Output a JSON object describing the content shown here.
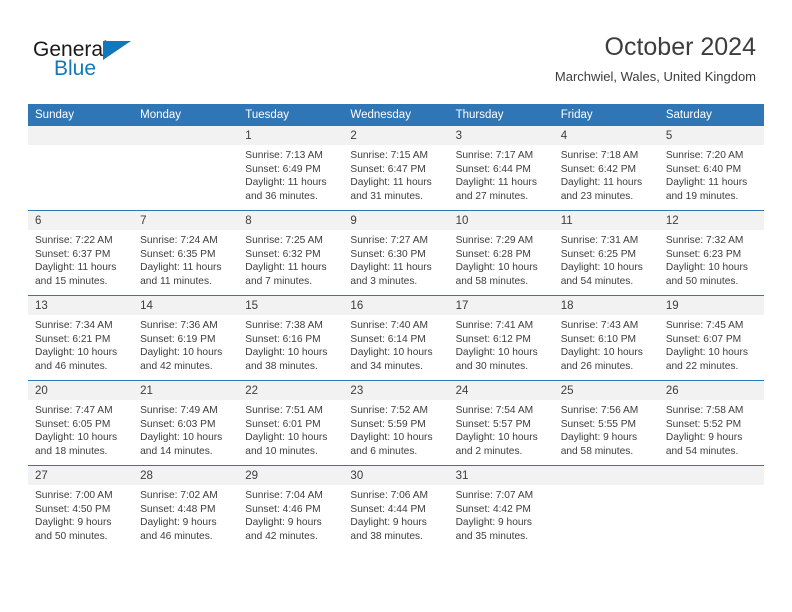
{
  "logo": {
    "word1": "General",
    "word2": "Blue",
    "triangle_color": "#1278be",
    "text_color": "#1a1a1a"
  },
  "header": {
    "title": "October 2024",
    "subtitle": "Marchwiel, Wales, United Kingdom"
  },
  "theme": {
    "header_bg": "#2f76b6",
    "daynum_bg": "#f2f2f2",
    "text": "#3d3d3d",
    "rule": "#2f76b6"
  },
  "weekday_headers": [
    "Sunday",
    "Monday",
    "Tuesday",
    "Wednesday",
    "Thursday",
    "Friday",
    "Saturday"
  ],
  "labels": {
    "sunrise_prefix": "Sunrise:",
    "sunset_prefix": "Sunset:",
    "daylight_prefix": "Daylight:"
  },
  "weeks": [
    [
      {
        "day": "",
        "sunrise": "",
        "sunset": "",
        "daylight_l1": "",
        "daylight_l2": ""
      },
      {
        "day": "",
        "sunrise": "",
        "sunset": "",
        "daylight_l1": "",
        "daylight_l2": ""
      },
      {
        "day": "1",
        "sunrise": "Sunrise: 7:13 AM",
        "sunset": "Sunset: 6:49 PM",
        "daylight_l1": "Daylight: 11 hours",
        "daylight_l2": "and 36 minutes."
      },
      {
        "day": "2",
        "sunrise": "Sunrise: 7:15 AM",
        "sunset": "Sunset: 6:47 PM",
        "daylight_l1": "Daylight: 11 hours",
        "daylight_l2": "and 31 minutes."
      },
      {
        "day": "3",
        "sunrise": "Sunrise: 7:17 AM",
        "sunset": "Sunset: 6:44 PM",
        "daylight_l1": "Daylight: 11 hours",
        "daylight_l2": "and 27 minutes."
      },
      {
        "day": "4",
        "sunrise": "Sunrise: 7:18 AM",
        "sunset": "Sunset: 6:42 PM",
        "daylight_l1": "Daylight: 11 hours",
        "daylight_l2": "and 23 minutes."
      },
      {
        "day": "5",
        "sunrise": "Sunrise: 7:20 AM",
        "sunset": "Sunset: 6:40 PM",
        "daylight_l1": "Daylight: 11 hours",
        "daylight_l2": "and 19 minutes."
      }
    ],
    [
      {
        "day": "6",
        "sunrise": "Sunrise: 7:22 AM",
        "sunset": "Sunset: 6:37 PM",
        "daylight_l1": "Daylight: 11 hours",
        "daylight_l2": "and 15 minutes."
      },
      {
        "day": "7",
        "sunrise": "Sunrise: 7:24 AM",
        "sunset": "Sunset: 6:35 PM",
        "daylight_l1": "Daylight: 11 hours",
        "daylight_l2": "and 11 minutes."
      },
      {
        "day": "8",
        "sunrise": "Sunrise: 7:25 AM",
        "sunset": "Sunset: 6:32 PM",
        "daylight_l1": "Daylight: 11 hours",
        "daylight_l2": "and 7 minutes."
      },
      {
        "day": "9",
        "sunrise": "Sunrise: 7:27 AM",
        "sunset": "Sunset: 6:30 PM",
        "daylight_l1": "Daylight: 11 hours",
        "daylight_l2": "and 3 minutes."
      },
      {
        "day": "10",
        "sunrise": "Sunrise: 7:29 AM",
        "sunset": "Sunset: 6:28 PM",
        "daylight_l1": "Daylight: 10 hours",
        "daylight_l2": "and 58 minutes."
      },
      {
        "day": "11",
        "sunrise": "Sunrise: 7:31 AM",
        "sunset": "Sunset: 6:25 PM",
        "daylight_l1": "Daylight: 10 hours",
        "daylight_l2": "and 54 minutes."
      },
      {
        "day": "12",
        "sunrise": "Sunrise: 7:32 AM",
        "sunset": "Sunset: 6:23 PM",
        "daylight_l1": "Daylight: 10 hours",
        "daylight_l2": "and 50 minutes."
      }
    ],
    [
      {
        "day": "13",
        "sunrise": "Sunrise: 7:34 AM",
        "sunset": "Sunset: 6:21 PM",
        "daylight_l1": "Daylight: 10 hours",
        "daylight_l2": "and 46 minutes."
      },
      {
        "day": "14",
        "sunrise": "Sunrise: 7:36 AM",
        "sunset": "Sunset: 6:19 PM",
        "daylight_l1": "Daylight: 10 hours",
        "daylight_l2": "and 42 minutes."
      },
      {
        "day": "15",
        "sunrise": "Sunrise: 7:38 AM",
        "sunset": "Sunset: 6:16 PM",
        "daylight_l1": "Daylight: 10 hours",
        "daylight_l2": "and 38 minutes."
      },
      {
        "day": "16",
        "sunrise": "Sunrise: 7:40 AM",
        "sunset": "Sunset: 6:14 PM",
        "daylight_l1": "Daylight: 10 hours",
        "daylight_l2": "and 34 minutes."
      },
      {
        "day": "17",
        "sunrise": "Sunrise: 7:41 AM",
        "sunset": "Sunset: 6:12 PM",
        "daylight_l1": "Daylight: 10 hours",
        "daylight_l2": "and 30 minutes."
      },
      {
        "day": "18",
        "sunrise": "Sunrise: 7:43 AM",
        "sunset": "Sunset: 6:10 PM",
        "daylight_l1": "Daylight: 10 hours",
        "daylight_l2": "and 26 minutes."
      },
      {
        "day": "19",
        "sunrise": "Sunrise: 7:45 AM",
        "sunset": "Sunset: 6:07 PM",
        "daylight_l1": "Daylight: 10 hours",
        "daylight_l2": "and 22 minutes."
      }
    ],
    [
      {
        "day": "20",
        "sunrise": "Sunrise: 7:47 AM",
        "sunset": "Sunset: 6:05 PM",
        "daylight_l1": "Daylight: 10 hours",
        "daylight_l2": "and 18 minutes."
      },
      {
        "day": "21",
        "sunrise": "Sunrise: 7:49 AM",
        "sunset": "Sunset: 6:03 PM",
        "daylight_l1": "Daylight: 10 hours",
        "daylight_l2": "and 14 minutes."
      },
      {
        "day": "22",
        "sunrise": "Sunrise: 7:51 AM",
        "sunset": "Sunset: 6:01 PM",
        "daylight_l1": "Daylight: 10 hours",
        "daylight_l2": "and 10 minutes."
      },
      {
        "day": "23",
        "sunrise": "Sunrise: 7:52 AM",
        "sunset": "Sunset: 5:59 PM",
        "daylight_l1": "Daylight: 10 hours",
        "daylight_l2": "and 6 minutes."
      },
      {
        "day": "24",
        "sunrise": "Sunrise: 7:54 AM",
        "sunset": "Sunset: 5:57 PM",
        "daylight_l1": "Daylight: 10 hours",
        "daylight_l2": "and 2 minutes."
      },
      {
        "day": "25",
        "sunrise": "Sunrise: 7:56 AM",
        "sunset": "Sunset: 5:55 PM",
        "daylight_l1": "Daylight: 9 hours",
        "daylight_l2": "and 58 minutes."
      },
      {
        "day": "26",
        "sunrise": "Sunrise: 7:58 AM",
        "sunset": "Sunset: 5:52 PM",
        "daylight_l1": "Daylight: 9 hours",
        "daylight_l2": "and 54 minutes."
      }
    ],
    [
      {
        "day": "27",
        "sunrise": "Sunrise: 7:00 AM",
        "sunset": "Sunset: 4:50 PM",
        "daylight_l1": "Daylight: 9 hours",
        "daylight_l2": "and 50 minutes."
      },
      {
        "day": "28",
        "sunrise": "Sunrise: 7:02 AM",
        "sunset": "Sunset: 4:48 PM",
        "daylight_l1": "Daylight: 9 hours",
        "daylight_l2": "and 46 minutes."
      },
      {
        "day": "29",
        "sunrise": "Sunrise: 7:04 AM",
        "sunset": "Sunset: 4:46 PM",
        "daylight_l1": "Daylight: 9 hours",
        "daylight_l2": "and 42 minutes."
      },
      {
        "day": "30",
        "sunrise": "Sunrise: 7:06 AM",
        "sunset": "Sunset: 4:44 PM",
        "daylight_l1": "Daylight: 9 hours",
        "daylight_l2": "and 38 minutes."
      },
      {
        "day": "31",
        "sunrise": "Sunrise: 7:07 AM",
        "sunset": "Sunset: 4:42 PM",
        "daylight_l1": "Daylight: 9 hours",
        "daylight_l2": "and 35 minutes."
      },
      {
        "day": "",
        "sunrise": "",
        "sunset": "",
        "daylight_l1": "",
        "daylight_l2": ""
      },
      {
        "day": "",
        "sunrise": "",
        "sunset": "",
        "daylight_l1": "",
        "daylight_l2": ""
      }
    ]
  ]
}
